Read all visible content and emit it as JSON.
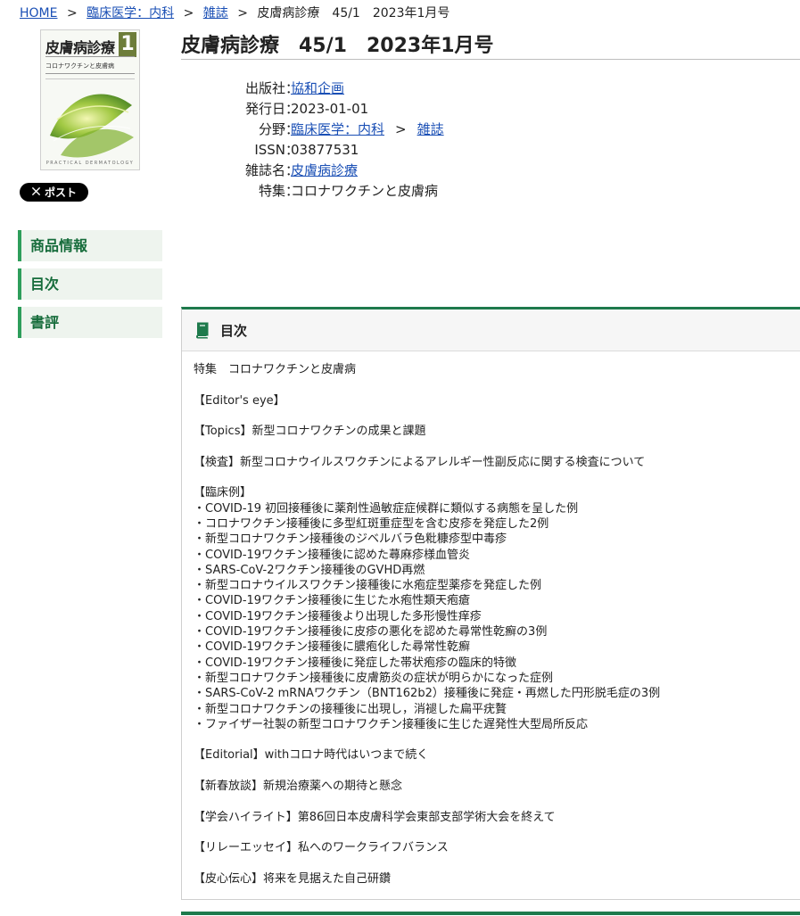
{
  "breadcrumb": {
    "home": "HOME",
    "category": "臨床医学：内科",
    "type": "雑誌",
    "current": "皮膚病診療　45/1　2023年1月号",
    "separator": ">"
  },
  "cover": {
    "title": "皮膚病診療",
    "issue_number": "1",
    "feature": "コロナワクチンと皮膚病",
    "footer": "PRACTICAL DERMATOLOGY",
    "accent_color": "#6d7d3a"
  },
  "share": {
    "post_label": "ポスト",
    "icon": "x-logo-icon"
  },
  "side_nav": [
    {
      "label": "商品情報"
    },
    {
      "label": "目次"
    },
    {
      "label": "書評"
    }
  ],
  "product": {
    "title": "皮膚病診療　45/1　2023年1月号",
    "publisher_label": "出版社",
    "publisher": "協和企画",
    "date_label": "発行日",
    "date": "2023-01-01",
    "field_label": "分野",
    "field_category": "臨床医学：内科",
    "field_separator": ">",
    "field_type": "雑誌",
    "issn_label": "ISSN",
    "issn": "03877531",
    "magazine_label": "雑誌名",
    "magazine": "皮膚病診療",
    "feature_label": "特集",
    "feature": "コロナワクチンと皮膚病",
    "colon": "："
  },
  "toc": {
    "title": "目次",
    "icon": "book-icon",
    "blocks": [
      [
        "特集　コロナワクチンと皮膚病"
      ],
      [
        "【Editor's eye】"
      ],
      [
        "【Topics】新型コロナワクチンの成果と課題"
      ],
      [
        "【検査】新型コロナウイルスワクチンによるアレルギー性副反応に関する検査について"
      ],
      [
        "【臨床例】",
        "・COVID-19 初回接種後に薬剤性過敏症症候群に類似する病態を呈した例",
        "・コロナワクチン接種後に多型紅斑重症型を含む皮疹を発症した2例",
        "・新型コロナワクチン接種後のジベルバラ色粃糠疹型中毒疹",
        "・COVID-19ワクチン接種後に認めた蕁麻疹様血管炎",
        "・SARS-CoV-2ワクチン接種後のGVHD再燃",
        "・新型コロナウイルスワクチン接種後に水疱症型薬疹を発症した例",
        "・COVID-19ワクチン接種後に生じた水疱性類天疱瘡",
        "・COVID-19ワクチン接種後より出現した多形慢性痒疹",
        "・COVID-19ワクチン接種後に皮疹の悪化を認めた尋常性乾癬の3例",
        "・COVID-19ワクチン接種後に膿疱化した尋常性乾癬",
        "・COVID-19ワクチン接種後に発症した帯状疱疹の臨床的特徴",
        "・新型コロナワクチン接種後に皮膚筋炎の症状が明らかになった症例",
        "・SARS-CoV-2 mRNAワクチン（BNT162b2）接種後に発症・再燃した円形脱毛症の3例",
        "・新型コロナワクチンの接種後に出現し，消褪した扁平疣贅",
        "・ファイザー社製の新型コロナワクチン接種後に生じた遅発性大型局所反応"
      ],
      [
        "【Editorial】withコロナ時代はいつまで続く"
      ],
      [
        "【新春放談】新規治療薬への期待と懸念"
      ],
      [
        "【学会ハイライト】第86回日本皮膚科学会東部支部学術大会を終えて"
      ],
      [
        "【リレーエッセイ】私へのワークライフバランス"
      ],
      [
        "【皮心伝心】将来を見据えた自己研鑽"
      ]
    ]
  },
  "colors": {
    "accent_green": "#1e7a4c",
    "link": "#1a4fb5",
    "nav_text": "#166c3b"
  }
}
